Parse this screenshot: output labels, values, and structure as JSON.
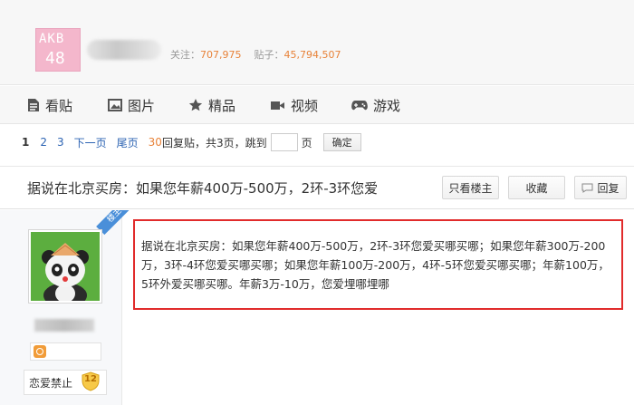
{
  "header": {
    "logo_text_line1": "AKB",
    "logo_text_line2": "48",
    "stats": {
      "follow_label": "关注：",
      "follow_count": "707,975",
      "posts_label": "贴子：",
      "posts_count": "45,794,507"
    }
  },
  "nav": {
    "items": [
      {
        "label": "看贴",
        "icon": "document-icon"
      },
      {
        "label": "图片",
        "icon": "image-icon"
      },
      {
        "label": "精品",
        "icon": "star-icon"
      },
      {
        "label": "视频",
        "icon": "video-icon"
      },
      {
        "label": "游戏",
        "icon": "gamepad-icon"
      }
    ]
  },
  "pager": {
    "current": "1",
    "pages": [
      "2",
      "3"
    ],
    "next": "下一页",
    "last": "尾页",
    "reply_count": "30",
    "summary": "回复贴，共3页，跳到",
    "page_suffix": "页",
    "confirm": "确定"
  },
  "thread": {
    "title": "据说在北京买房：如果您年薪400万-500万，2环-3环您爱",
    "buttons": {
      "only_op": "只看楼主",
      "favorite": "收藏",
      "reply": "回复"
    }
  },
  "user": {
    "ribbon": "楼主",
    "forum_tag": "恋爱禁止",
    "level": "12"
  },
  "post": {
    "content": "据说在北京买房：如果您年薪400万-500万，2环-3环您爱买哪买哪；如果您年薪300万-200万，3环-4环您爱买哪买哪；如果您年薪100万-200万，4环-5环您爱买哪买哪；年薪100万，5环外爱买哪买哪。年薪3万-10万，您爱埋哪埋哪"
  },
  "colors": {
    "accent_orange": "#e8833a",
    "link_blue": "#2d64b3",
    "highlight_red": "#e12b2b",
    "logo_pink": "#f4b7cc"
  }
}
